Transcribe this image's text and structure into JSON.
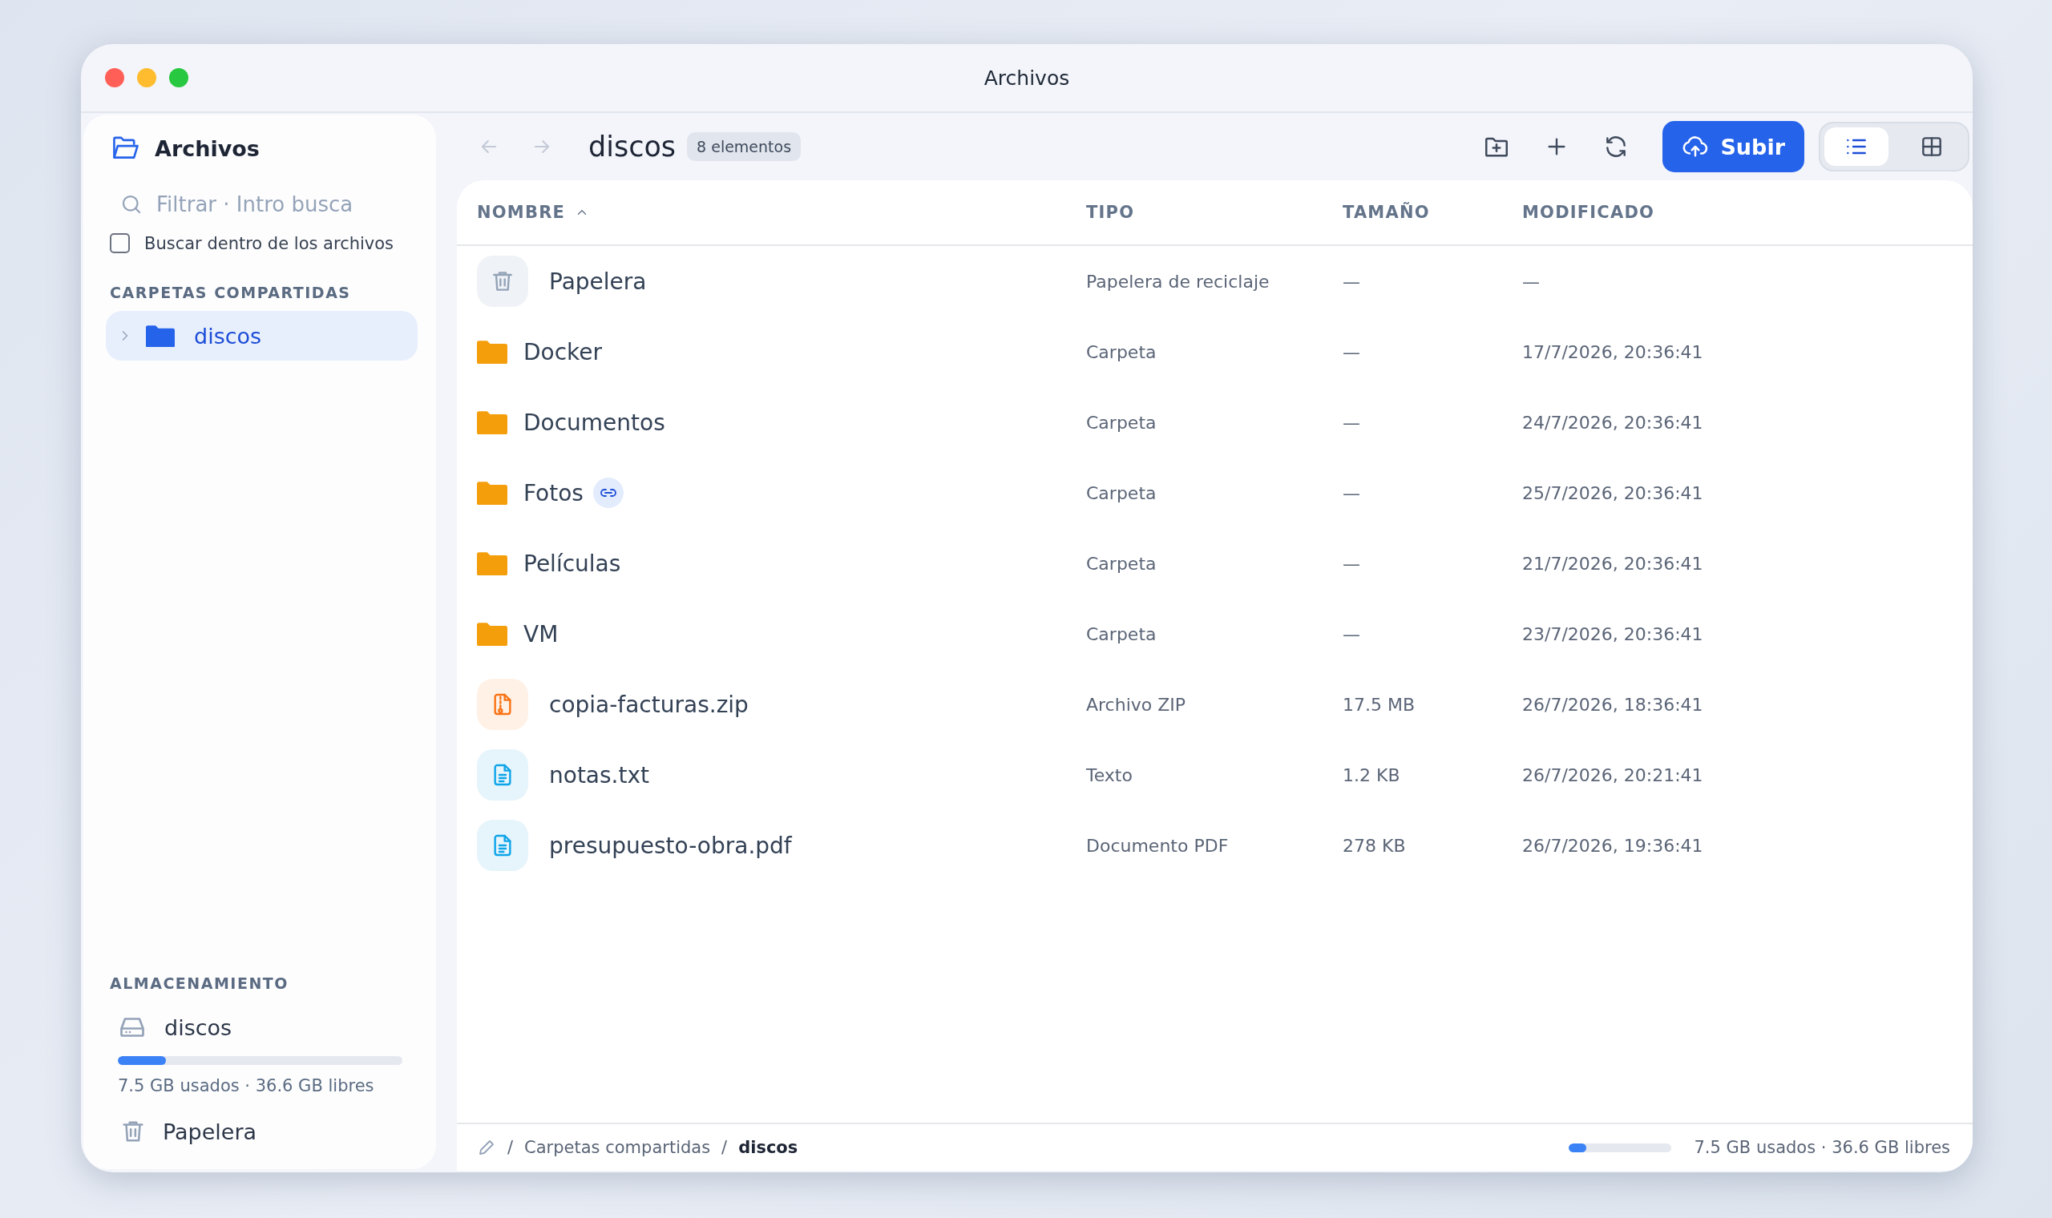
{
  "window": {
    "title": "Archivos"
  },
  "sidebar": {
    "app_title": "Archivos",
    "search": {
      "placeholder": "Filtrar · Intro busca"
    },
    "search_contents": {
      "label": "Buscar dentro de los archivos",
      "checked": false
    },
    "shared_section": {
      "heading": "CARPETAS COMPARTIDAS",
      "items": [
        {
          "label": "discos",
          "selected": true,
          "expanded": false
        }
      ]
    },
    "storage_section": {
      "heading": "ALMACENAMIENTO",
      "volume": {
        "name": "discos",
        "level": 0.17,
        "usage": "7.5 GB usados · 36.6 GB libres"
      }
    },
    "trash": {
      "label": "Papelera"
    }
  },
  "toolbar": {
    "back": {
      "disabled": true
    },
    "forward": {
      "disabled": true
    },
    "folder_title": "discos",
    "count_badge": "8 elementos",
    "upload_button": "Subir",
    "views": [
      {
        "kind": "list",
        "selected": true
      },
      {
        "kind": "grid",
        "selected": false
      }
    ]
  },
  "table": {
    "columns": [
      {
        "label": "NOMBRE",
        "sorted": true
      },
      {
        "label": "TIPO",
        "sorted": false
      },
      {
        "label": "TAMAÑO",
        "sorted": false
      },
      {
        "label": "MODIFICADO",
        "sorted": false
      }
    ],
    "rows": [
      {
        "kind": "trash",
        "name": "Papelera",
        "shared": false,
        "type": "Papelera de reciclaje",
        "size": "—",
        "modified": "—"
      },
      {
        "kind": "folder",
        "name": "Docker",
        "shared": false,
        "type": "Carpeta",
        "size": "—",
        "modified": "17/7/2026, 20:36:41"
      },
      {
        "kind": "folder",
        "name": "Documentos",
        "shared": false,
        "type": "Carpeta",
        "size": "—",
        "modified": "24/7/2026, 20:36:41"
      },
      {
        "kind": "folder",
        "name": "Fotos",
        "shared": true,
        "type": "Carpeta",
        "size": "—",
        "modified": "25/7/2026, 20:36:41"
      },
      {
        "kind": "folder",
        "name": "Películas",
        "shared": false,
        "type": "Carpeta",
        "size": "—",
        "modified": "21/7/2026, 20:36:41"
      },
      {
        "kind": "folder",
        "name": "VM",
        "shared": false,
        "type": "Carpeta",
        "size": "—",
        "modified": "23/7/2026, 20:36:41"
      },
      {
        "kind": "zip",
        "name": "copia-facturas.zip",
        "shared": false,
        "type": "Archivo ZIP",
        "size": "17.5 MB",
        "modified": "26/7/2026, 18:36:41"
      },
      {
        "kind": "text",
        "name": "notas.txt",
        "shared": false,
        "type": "Texto",
        "size": "1.2 KB",
        "modified": "26/7/2026, 20:21:41"
      },
      {
        "kind": "text",
        "name": "presupuesto-obra.pdf",
        "shared": false,
        "type": "Documento PDF",
        "size": "278 KB",
        "modified": "26/7/2026, 19:36:41"
      }
    ]
  },
  "footer": {
    "separator": "/",
    "breadcrumbs": [
      {
        "label": "Carpetas compartidas",
        "current": false
      },
      {
        "label": "discos",
        "current": true
      }
    ],
    "level": 0.17,
    "usage": "7.5 GB usados · 36.6 GB libres"
  }
}
